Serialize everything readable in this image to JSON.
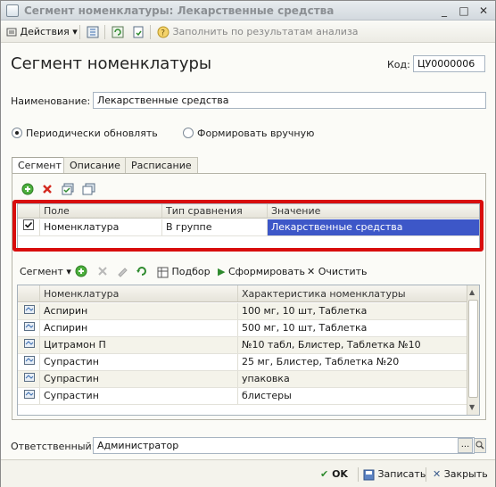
{
  "window": {
    "title": "Сегмент номенклатуры: Лекарственные средства"
  },
  "toolbar": {
    "actions_label": "Действия",
    "fill_label": "Заполнить по результатам анализа"
  },
  "header": {
    "title": "Сегмент номенклатуры",
    "code_label": "Код:",
    "code_value": "ЦУ0000006"
  },
  "name": {
    "label": "Наименование:",
    "value": "Лекарственные средства"
  },
  "radios": {
    "periodic": "Периодически обновлять",
    "manual": "Формировать вручную",
    "selected": "periodic"
  },
  "tabs": [
    "Сегмент",
    "Описание",
    "Расписание"
  ],
  "conditions": {
    "columns": [
      "Поле",
      "Тип сравнения",
      "Значение"
    ],
    "rows": [
      {
        "checked": true,
        "field": "Номенклатура",
        "comparison": "В группе",
        "value": "Лекарственные средства"
      }
    ]
  },
  "segment_toolbar": {
    "segment_label": "Сегмент",
    "pick_label": "Подбор",
    "build_label": "Сформировать",
    "clear_label": "Очистить"
  },
  "items": {
    "columns": [
      "Номенклатура",
      "Характеристика номенклатуры"
    ],
    "rows": [
      {
        "name": "Аспирин",
        "spec": "100 мг, 10 шт, Таблетка"
      },
      {
        "name": "Аспирин",
        "spec": "500 мг, 10 шт, Таблетка"
      },
      {
        "name": "Цитрамон П",
        "spec": "№10 табл, Блистер, Таблетка №10"
      },
      {
        "name": "Супрастин",
        "spec": "25 мг, Блистер, Таблетка №20"
      },
      {
        "name": "Супрастин",
        "spec": "упаковка"
      },
      {
        "name": "Супрастин",
        "spec": "блистеры"
      }
    ]
  },
  "responsible": {
    "label": "Ответственный:",
    "value": "Администратор",
    "button": "..."
  },
  "buttons": {
    "ok": "OK",
    "save": "Записать",
    "close": "Закрыть"
  },
  "colors": {
    "highlight": "#3d57c8",
    "red_frame": "#d80d0d"
  }
}
